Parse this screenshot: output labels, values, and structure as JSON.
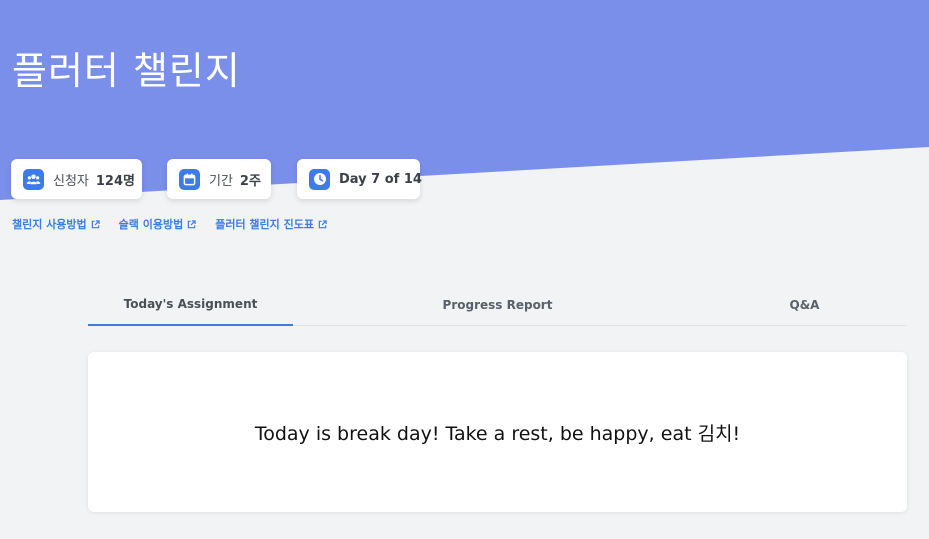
{
  "header": {
    "title": "플러터 챌린지"
  },
  "stats": [
    {
      "icon": "people-icon",
      "label": "신청자",
      "value": "124명"
    },
    {
      "icon": "calendar-icon",
      "label": "기간",
      "value": "2주"
    },
    {
      "icon": "clock-icon",
      "label": "",
      "value": "Day 7 of 14"
    }
  ],
  "links": [
    {
      "label": "챌린지 사용방법",
      "icon": "external-link-icon"
    },
    {
      "label": "슬랙 이용방법",
      "icon": "external-link-icon"
    },
    {
      "label": "플러터 챌린지 진도표",
      "icon": "external-link-icon"
    }
  ],
  "tabs": [
    {
      "label": "Today's Assignment",
      "active": true
    },
    {
      "label": "Progress Report",
      "active": false
    },
    {
      "label": "Q&A",
      "active": false
    }
  ],
  "content": {
    "message": "Today is break day! Take a rest, be happy, eat 김치!"
  },
  "colors": {
    "hero": "#7a8fea",
    "accent": "#3d7be8",
    "background": "#f1f3f5"
  }
}
